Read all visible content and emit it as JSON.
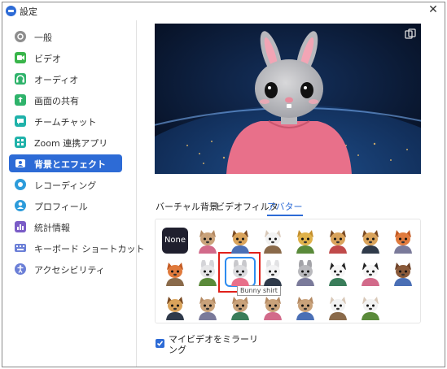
{
  "window": {
    "title": "設定",
    "close_glyph": "✕"
  },
  "sidebar": {
    "items": [
      {
        "label": "一般",
        "icon": "gear-icon",
        "color": "#8e8e8e"
      },
      {
        "label": "ビデオ",
        "icon": "video-icon",
        "color": "#39b54a"
      },
      {
        "label": "オーディオ",
        "icon": "headphones-icon",
        "color": "#2fb36b"
      },
      {
        "label": "画面の共有",
        "icon": "share-screen-icon",
        "color": "#2fb36b"
      },
      {
        "label": "チームチャット",
        "icon": "chat-icon",
        "color": "#20b2aa"
      },
      {
        "label": "Zoom 連携アプリ",
        "icon": "apps-icon",
        "color": "#20b2aa"
      },
      {
        "label": "背景とエフェクト",
        "icon": "background-icon",
        "color": "#ffffff",
        "active": true
      },
      {
        "label": "レコーディング",
        "icon": "record-icon",
        "color": "#2d9cdb"
      },
      {
        "label": "プロフィール",
        "icon": "profile-icon",
        "color": "#2d9cdb"
      },
      {
        "label": "統計情報",
        "icon": "statistics-icon",
        "color": "#7a5cc7"
      },
      {
        "label": "キーボード ショートカット",
        "icon": "keyboard-icon",
        "color": "#6b7fd7"
      },
      {
        "label": "アクセシビリティ",
        "icon": "accessibility-icon",
        "color": "#6b7fd7"
      }
    ]
  },
  "preview": {
    "avatar": "bunny-avatar",
    "background": "earth-from-space",
    "pip_icon": "pip-icon"
  },
  "tabs": [
    {
      "label": "バーチャル背景"
    },
    {
      "label": "ビデオフィルタ"
    },
    {
      "label": "アバター",
      "active": true
    }
  ],
  "avatars": {
    "none_label": "None",
    "selected_tooltip": "Bunny shirt",
    "rows": [
      [
        "none",
        "cat",
        "dog",
        "cow",
        "lion",
        "dog",
        "dog",
        "fox"
      ],
      [
        "fox",
        "bunny-dark",
        "bunny-shirt",
        "bunny-white",
        "bunny-grey",
        "panda",
        "panda",
        "bear"
      ],
      [
        "dog",
        "cat",
        "cat",
        "cat",
        "cat",
        "cow",
        "cow"
      ]
    ]
  },
  "mirror": {
    "label": "マイビデオをミラーリング",
    "checked": true
  },
  "colors": {
    "accent": "#2d6bd6",
    "highlight": "#e0201a"
  }
}
